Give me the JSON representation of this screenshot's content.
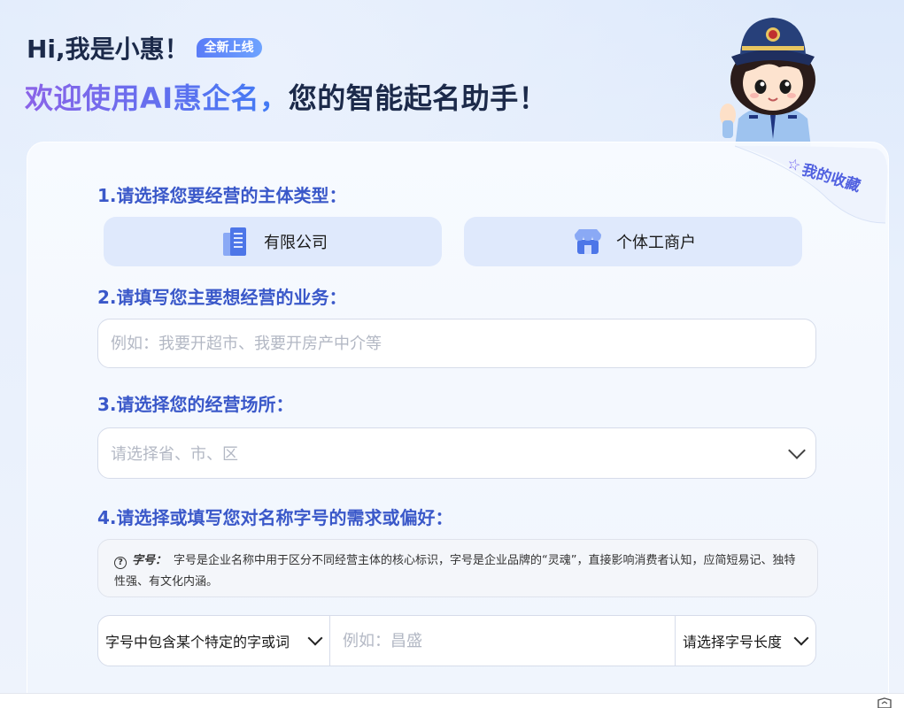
{
  "header": {
    "greeting": "Hi,我是小惠！",
    "new_badge": "全新上线",
    "headline_part1": "欢迎使用AI惠企名，",
    "headline_part2": "您的智能起名助手！"
  },
  "favorites": {
    "label": "我的收藏",
    "icon": "star-outline-icon"
  },
  "step1": {
    "title": "1.请选择您要经营的主体类型：",
    "options": [
      {
        "label": "有限公司",
        "icon": "office-building-icon"
      },
      {
        "label": "个体工商户",
        "icon": "storefront-icon"
      }
    ]
  },
  "step2": {
    "title": "2.请填写您主要想经营的业务：",
    "placeholder": "例如：我要开超市、我要开房产中介等"
  },
  "step3": {
    "title": "3.请选择您的经营场所：",
    "placeholder": "请选择省、市、区"
  },
  "step4": {
    "title": "4.请选择或填写您对名称字号的需求或偏好：",
    "tip_key": "字号：",
    "tip_text": "字号是企业名称中用于区分不同经营主体的核心标识，字号是企业品牌的“灵魂”，直接影响消费者认知，应简短易记、独特性强、有文化内涵。",
    "mode_select": "字号中包含某个特定的字或词",
    "word_placeholder": "例如：昌盛",
    "length_select": "请选择字号长度"
  },
  "colors": {
    "accent": "#3a58c9",
    "badge": "#5a7cf7",
    "card_option_bg": "#dfe9fc"
  }
}
